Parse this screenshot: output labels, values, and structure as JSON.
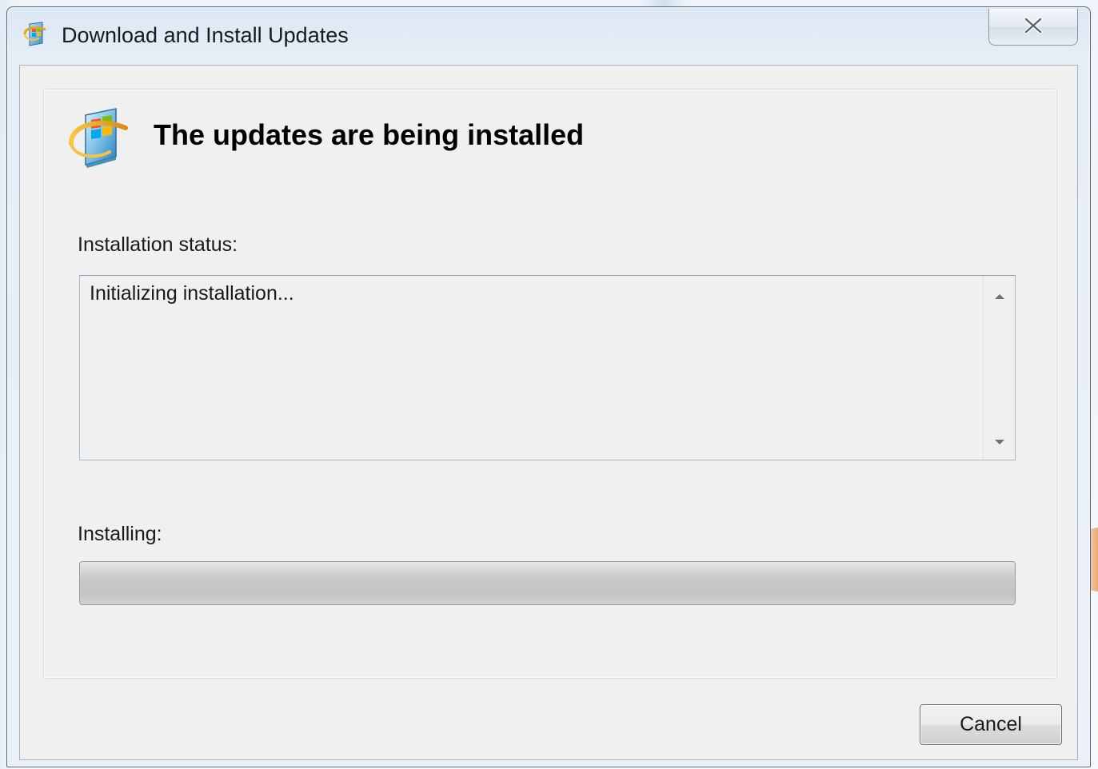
{
  "window": {
    "title": "Download and Install Updates",
    "title_icon": "windows-update-icon",
    "close_icon": "close-icon"
  },
  "main": {
    "heading": "The updates are being installed",
    "heading_icon": "windows-update-icon",
    "status_label": "Installation status:",
    "status_text": "Initializing installation...",
    "installing_label": "Installing:",
    "progress": 0
  },
  "buttons": {
    "cancel": "Cancel"
  },
  "colors": {
    "dialog_background": "#f0f0f0",
    "frame": "#dbe7f3"
  }
}
